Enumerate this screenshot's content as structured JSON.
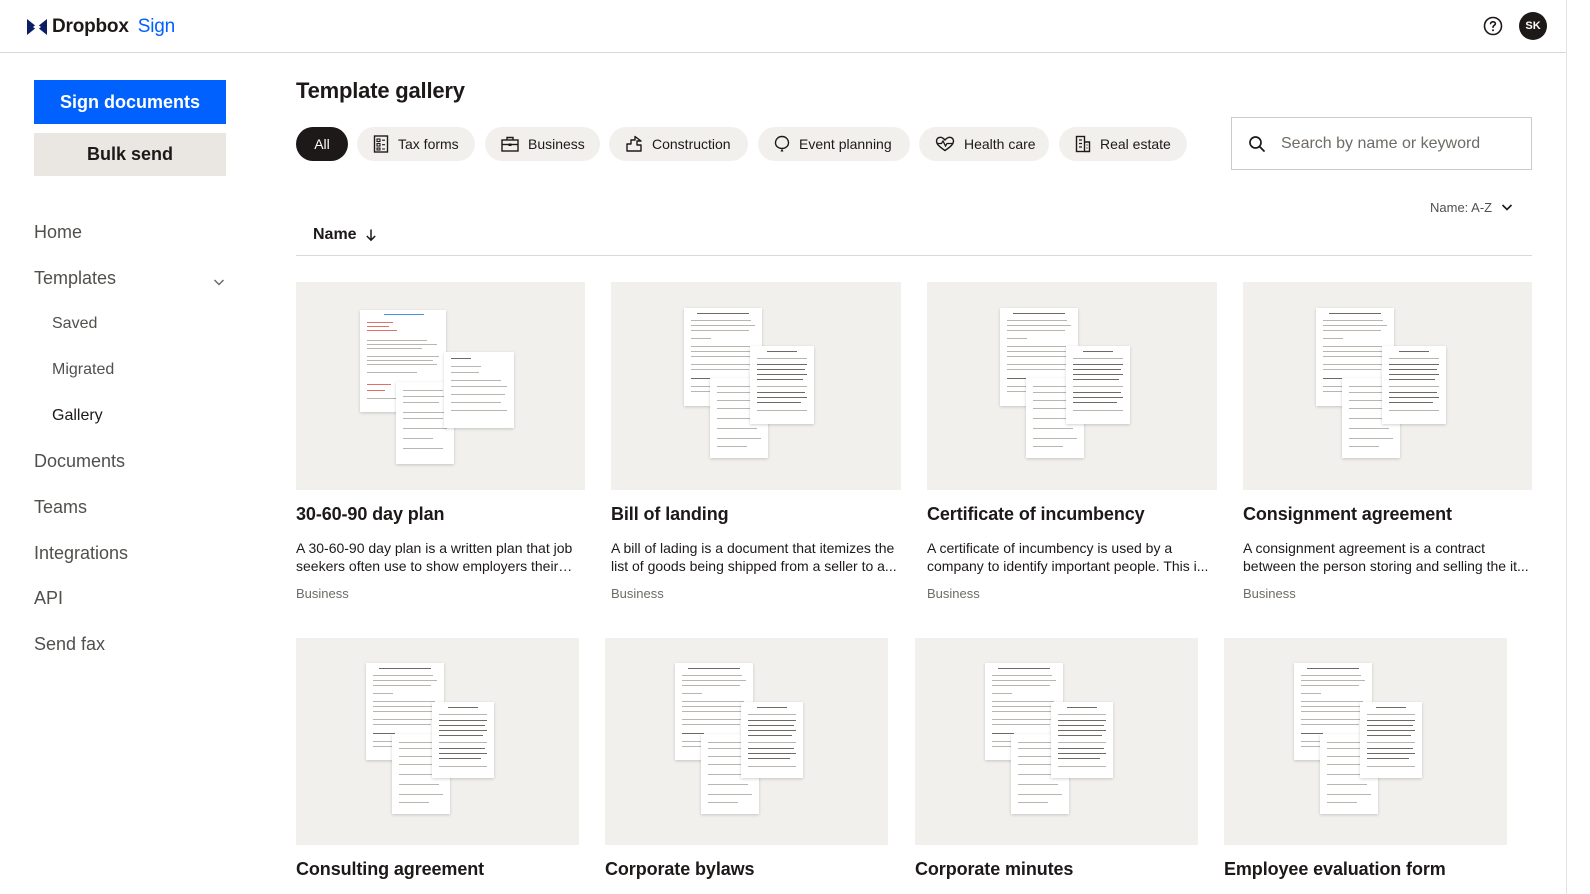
{
  "app": {
    "brand_main": "Dropbox",
    "brand_sub": "Sign",
    "avatar_initials": "SK"
  },
  "sidebar": {
    "primary_button": "Sign documents",
    "secondary_button": "Bulk send",
    "items": [
      {
        "label": "Home"
      },
      {
        "label": "Templates",
        "expanded": true
      },
      {
        "label": "Saved"
      },
      {
        "label": "Migrated"
      },
      {
        "label": "Gallery",
        "active": true
      },
      {
        "label": "Documents"
      },
      {
        "label": "Teams"
      },
      {
        "label": "Integrations"
      },
      {
        "label": "API"
      },
      {
        "label": "Send fax"
      }
    ]
  },
  "main": {
    "title": "Template gallery",
    "filters": [
      {
        "label": "All",
        "active": true,
        "icon": ""
      },
      {
        "label": "Tax forms",
        "icon": "tax-form-icon"
      },
      {
        "label": "Business",
        "icon": "briefcase-icon"
      },
      {
        "label": "Construction",
        "icon": "hammer-icon"
      },
      {
        "label": "Event planning",
        "icon": "balloon-icon"
      },
      {
        "label": "Health care",
        "icon": "heart-pulse-icon"
      },
      {
        "label": "Real estate",
        "icon": "building-icon"
      }
    ],
    "search": {
      "placeholder": "Search by name or keyword",
      "value": ""
    },
    "sort": {
      "label": "Name: A-Z"
    },
    "column_header": "Name",
    "templates": [
      {
        "title": "30-60-90 day plan",
        "description": "A 30-60-90 day plan is a written plan that job seekers often use to show employers their pr...",
        "category": "Business"
      },
      {
        "title": "Bill of landing",
        "description": "A bill of lading is a document that itemizes the list of goods being shipped from a seller to a...",
        "category": "Business"
      },
      {
        "title": "Certificate of incumbency",
        "description": "A certificate of incumbency is used by a company to identify important people. This i...",
        "category": "Business"
      },
      {
        "title": "Consignment agreement",
        "description": "A consignment agreement is a contract between the person storing and selling the it...",
        "category": "Business"
      },
      {
        "title": "Consulting agreement",
        "description": "",
        "category": ""
      },
      {
        "title": "Corporate bylaws",
        "description": "",
        "category": ""
      },
      {
        "title": "Corporate minutes",
        "description": "",
        "category": ""
      },
      {
        "title": "Employee evaluation form",
        "description": "",
        "category": ""
      }
    ]
  },
  "colors": {
    "accent": "#0061fe",
    "text": "#1e1919",
    "chip_bg": "#f2f0ed",
    "secondary_button_bg": "#eae6e2"
  }
}
